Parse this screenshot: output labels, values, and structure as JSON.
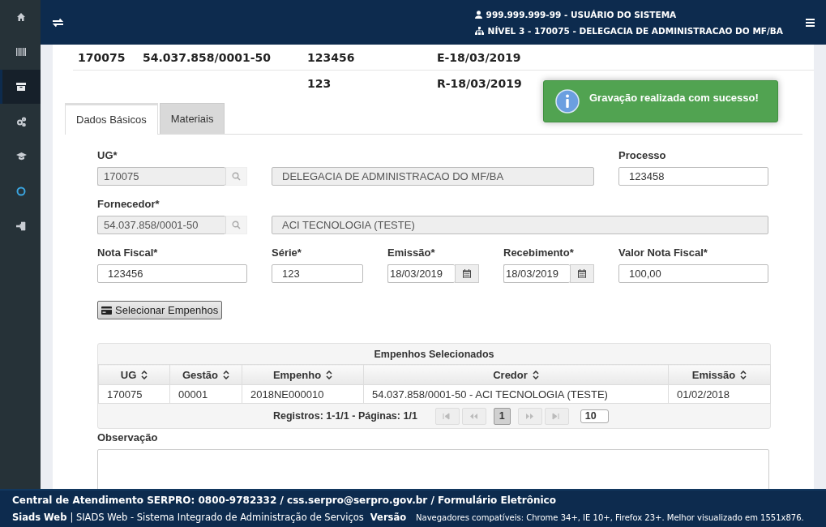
{
  "sidebar": {
    "items": [
      {
        "selected": false
      },
      {
        "selected": false
      },
      {
        "selected": true
      },
      {
        "selected": false
      },
      {
        "selected": false
      },
      {
        "selected": false
      },
      {
        "selected": false
      }
    ]
  },
  "header": {
    "user": "999.999.999-99 - USUÁRIO DO SISTEMA",
    "level": "NÍVEL 3 - 170075 - DELEGACIA DE ADMINISTRACAO DO MF/BA"
  },
  "summary": {
    "rows": [
      {
        "column_1": "170075",
        "column_2": "54.037.858/0001-50",
        "column_3": "123456",
        "column_4": "E-18/03/2019"
      },
      {
        "column_3": "123",
        "column_4": "R-18/03/2019"
      }
    ]
  },
  "toast": {
    "message": "Gravação realizada com sucesso!"
  },
  "tabs": [
    {
      "label": "Dados Básicos",
      "selected": true
    },
    {
      "label": "Materiais",
      "selected": false
    }
  ],
  "form": {
    "rows": [
      {
        "fields": [
          {
            "kind": "lookup",
            "label": "UG*",
            "value": "170075",
            "readonly": true
          },
          {
            "kind": "description",
            "value": "DELEGACIA DE ADMINISTRACAO DO MF/BA",
            "readonly": true
          },
          {
            "kind": "text",
            "label": "Processo",
            "value": "123458",
            "readonly": false
          }
        ]
      },
      {
        "fields": [
          {
            "kind": "lookup",
            "label": "Fornecedor*",
            "value": "54.037.858/0001-50",
            "readonly": true
          },
          {
            "kind": "description",
            "value": "ACI TECNOLOGIA (TESTE)",
            "readonly": true
          }
        ]
      },
      {
        "fields": [
          {
            "kind": "text",
            "label": "Nota Fiscal*",
            "value": "123456",
            "readonly": false
          },
          {
            "kind": "text",
            "label": "Série*",
            "value": "123",
            "readonly": false
          },
          {
            "kind": "date",
            "label": "Emissão*",
            "value": "18/03/2019",
            "readonly": false
          },
          {
            "kind": "date",
            "label": "Recebimento*",
            "value": "18/03/2019",
            "readonly": false
          },
          {
            "kind": "text",
            "label": "Valor Nota Fiscal*",
            "value": "100,00",
            "readonly": false
          }
        ]
      }
    ]
  },
  "select_button": {
    "label": "Selecionar Empenhos"
  },
  "table": {
    "title": "Empenhos Selecionados",
    "columns": [
      "UG",
      "Gestão",
      "Empenho",
      "Credor",
      "Emissão"
    ],
    "rows": [
      [
        "170075",
        "00001",
        "2018NE000010",
        "54.037.858/0001-50 - ACI TECNOLOGIA (TESTE)",
        "01/02/2018"
      ]
    ],
    "pager": {
      "records": "Registros: 1-1/1 - Páginas: 1/1",
      "pages": [
        {
          "label": "1",
          "selected": true
        }
      ],
      "page_size": "10"
    }
  },
  "observation": {
    "label": "Observação"
  },
  "footer": {
    "contact": "Central de Atendimento SERPRO: 0800-9782332 / css.serpro@serpro.gov.br / Formulário Eletrônico",
    "brand": "Siads Web",
    "system": "| SIADS Web - Sistema Integrado de Administração de Serviços",
    "version": "Versão",
    "browsers": "Navegadores compatíveis: Chrome 34+, IE 10+, Firefox 23+. Melhor visualizado em 1551x876."
  }
}
